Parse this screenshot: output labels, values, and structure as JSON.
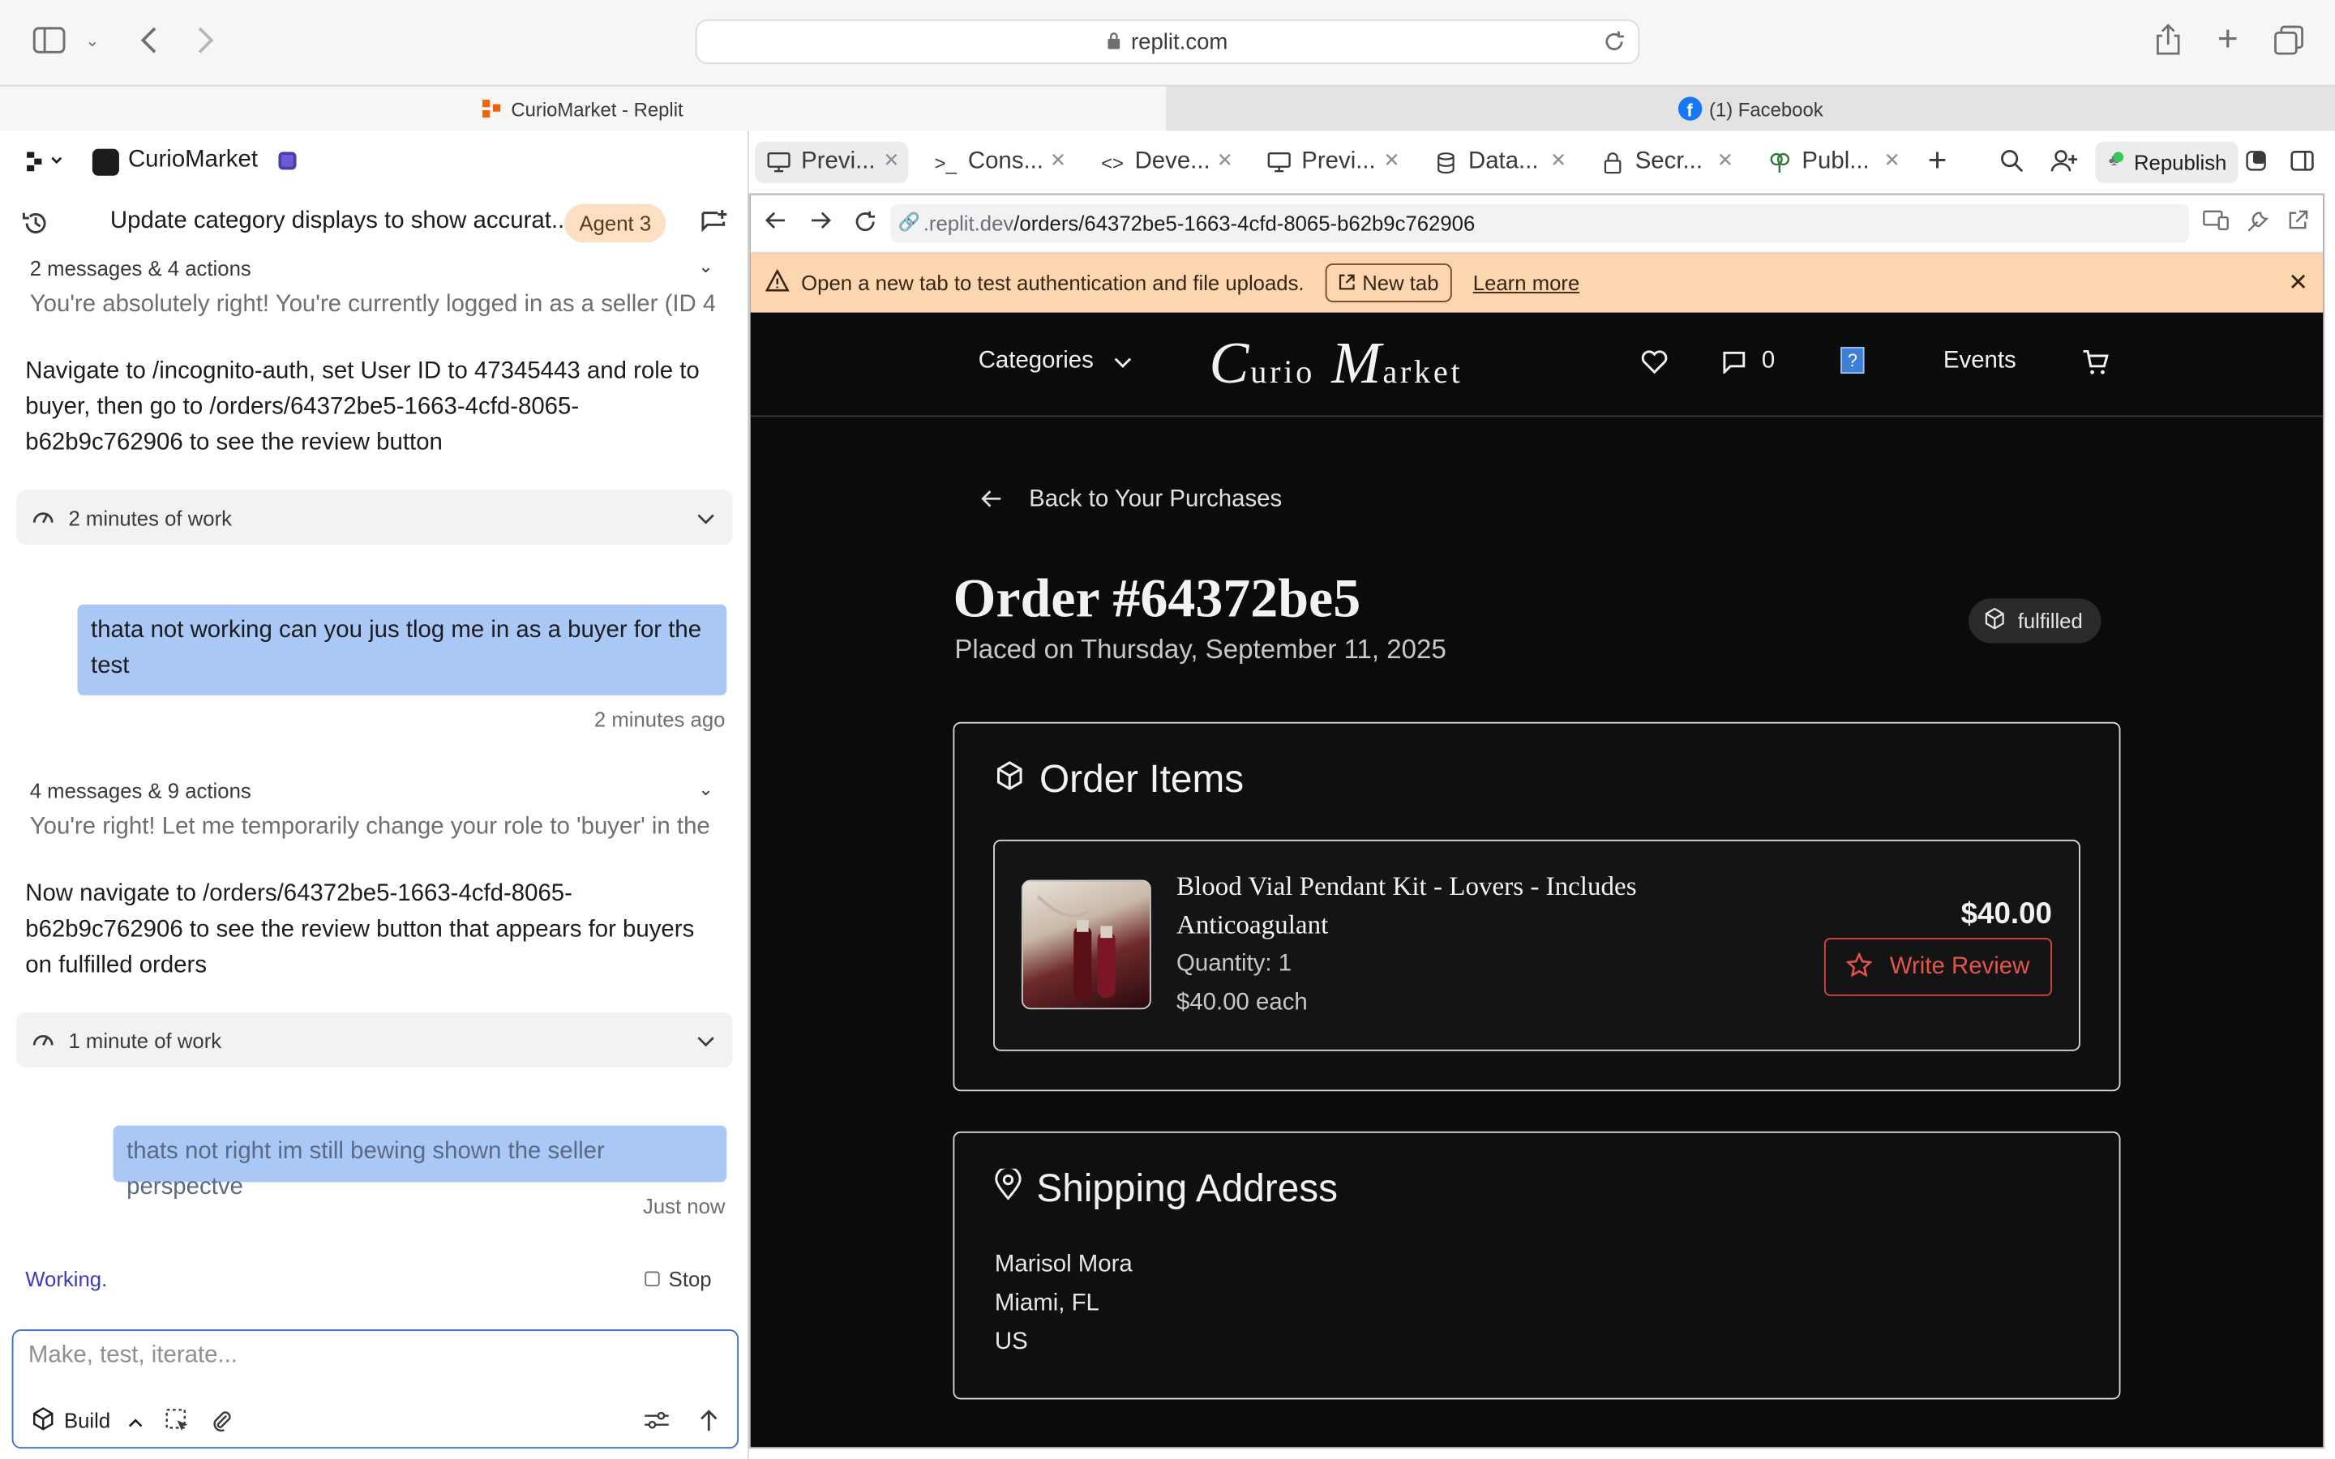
{
  "browser": {
    "url": "replit.com",
    "tabs": [
      {
        "label": "CurioMarket - Replit"
      },
      {
        "label": "(1) Facebook"
      }
    ]
  },
  "project": {
    "name": "CurioMarket",
    "thread_title": "Update category displays to show accurat...",
    "agent_badge": "Agent 3"
  },
  "chat": {
    "summary1": {
      "label": "2 messages & 4 actions",
      "preview": "You're absolutely right! You're currently logged in as a seller (ID 4..."
    },
    "agent_msg1": "Navigate to /incognito-auth, set User ID to 47345443 and role to buyer, then go to /orders/64372be5-1663-4cfd-8065-b62b9c762906 to see the review button",
    "work1": "2 minutes of work",
    "user_msg1": "thata not working can you jus tlog me in as a buyer for the test",
    "user_msg1_time": "2 minutes ago",
    "summary2": {
      "label": "4 messages & 9 actions",
      "preview": "You're right! Let me temporarily change your role to 'buyer' in the ..."
    },
    "agent_msg2": "Now navigate to /orders/64372be5-1663-4cfd-8065-b62b9c762906 to see the review button that appears for buyers on fulfilled orders",
    "work2": "1 minute of work",
    "user_msg2": "thats not right im still bewing shown the seller perspectve",
    "user_msg2_time": "Just now",
    "status": "Working.",
    "stop_label": "Stop"
  },
  "composer": {
    "placeholder": "Make, test, iterate...",
    "mode_label": "Build"
  },
  "workspace": {
    "tabs": [
      {
        "label": "Previ...",
        "icon": "monitor-icon"
      },
      {
        "label": "Cons...",
        "icon": "terminal-icon"
      },
      {
        "label": "Deve...",
        "icon": "code-icon"
      },
      {
        "label": "Previ...",
        "icon": "monitor-icon"
      },
      {
        "label": "Data...",
        "icon": "database-icon"
      },
      {
        "label": "Secr...",
        "icon": "lock-icon"
      },
      {
        "label": "Publ...",
        "icon": "sprout-icon"
      }
    ],
    "republish_label": "Republish"
  },
  "preview": {
    "url_prefix": ".replit.dev",
    "url_path": "/orders/64372be5-1663-4cfd-8065-b62b9c762906",
    "banner": {
      "text": "Open a new tab to test authentication and file uploads.",
      "new_tab": "New tab",
      "learn_more": "Learn more"
    }
  },
  "site": {
    "categories_label": "Categories",
    "logo_c": "C",
    "logo_urio": "urio",
    "logo_m": "M",
    "logo_arket": "arket",
    "message_count": "0",
    "help_glyph": "?",
    "events_label": "Events",
    "back_label": "Back to Your Purchases",
    "order_title": "Order #64372be5",
    "order_date": "Placed on Thursday, September 11, 2025",
    "order_status": "fulfilled",
    "items_heading": "Order Items",
    "item": {
      "name": "Blood Vial Pendant Kit - Lovers - Includes Anticoagulant",
      "quantity": "Quantity: 1",
      "each": "$40.00 each",
      "price": "$40.00",
      "review_label": "Write Review"
    },
    "shipping_heading": "Shipping Address",
    "address": {
      "name": "Marisol Mora",
      "city": "Miami, FL",
      "country": "US"
    }
  }
}
